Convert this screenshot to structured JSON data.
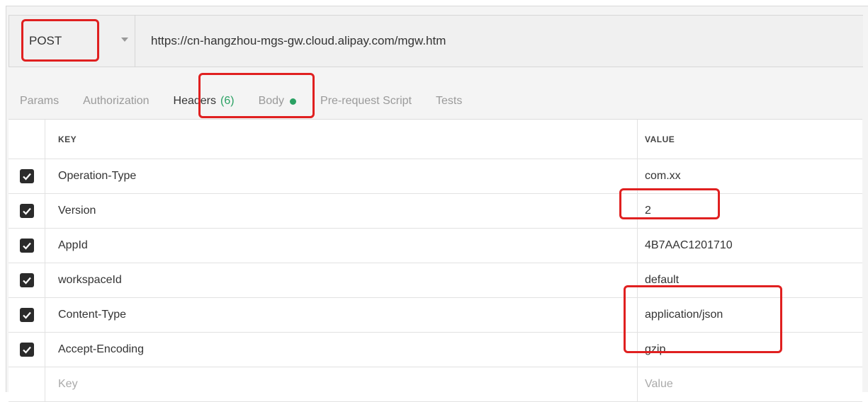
{
  "request": {
    "method": "POST",
    "url": "https://cn-hangzhou-mgs-gw.cloud.alipay.com/mgw.htm"
  },
  "tabs": [
    {
      "label": "Params"
    },
    {
      "label": "Authorization"
    },
    {
      "label": "Headers",
      "count": "(6)"
    },
    {
      "label": "Body"
    },
    {
      "label": "Pre-request Script"
    },
    {
      "label": "Tests"
    }
  ],
  "table": {
    "columns": {
      "key": "KEY",
      "value": "VALUE"
    },
    "rows": [
      {
        "key": "Operation-Type",
        "value": "com.xx",
        "checked": true
      },
      {
        "key": "Version",
        "value": "2",
        "checked": true
      },
      {
        "key": "AppId",
        "value": "4B7AAC1201710",
        "checked": true
      },
      {
        "key": "workspaceId",
        "value": "default",
        "checked": true
      },
      {
        "key": "Content-Type",
        "value": "application/json",
        "checked": true
      },
      {
        "key": "Accept-Encoding",
        "value": "gzip",
        "checked": true
      }
    ],
    "new_row": {
      "key_placeholder": "Key",
      "value_placeholder": "Value"
    }
  },
  "colors": {
    "accent_green": "#2aa163",
    "highlight_red": "#e02020",
    "checkbox": "#2b2b2b"
  }
}
